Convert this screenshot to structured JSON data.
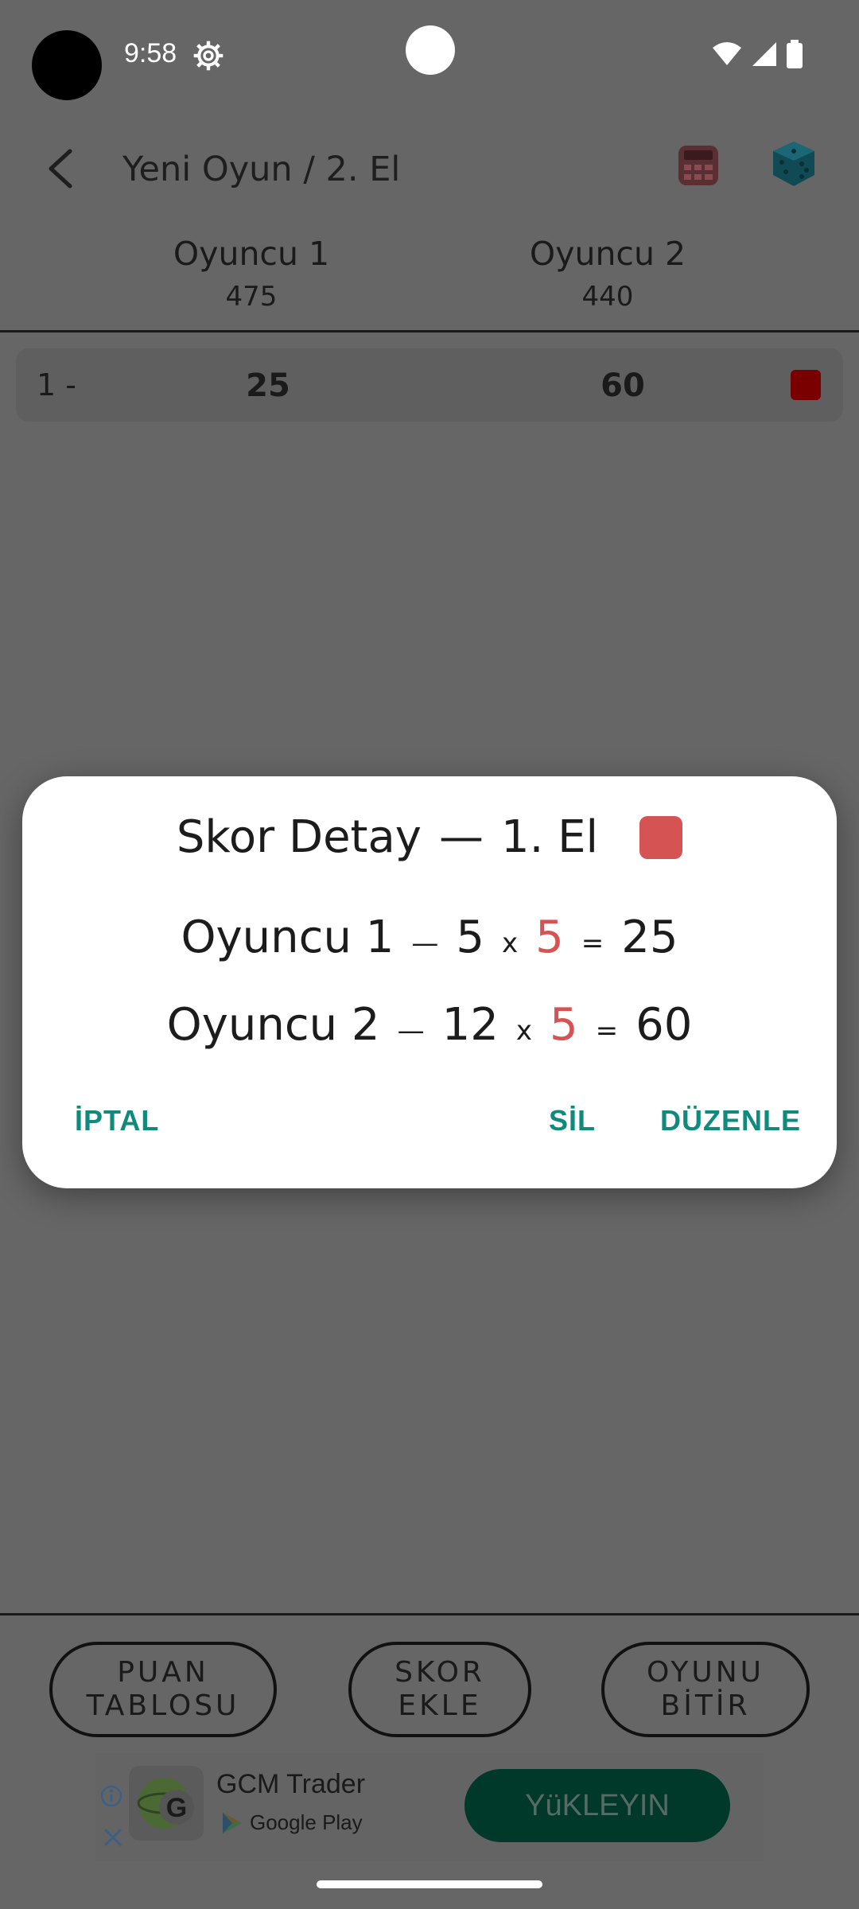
{
  "status_bar": {
    "time": "9:58"
  },
  "app_bar": {
    "title": "Yeni Oyun  /  2. El",
    "icons": [
      "back-arrow-icon",
      "calculator-icon",
      "dice-icon"
    ]
  },
  "players": [
    {
      "name": "Oyuncu 1",
      "score": "475"
    },
    {
      "name": "Oyuncu 2",
      "score": "440"
    }
  ],
  "rounds": [
    {
      "index": "1 -",
      "p1": "25",
      "p2": "60",
      "color": "#7a0000"
    }
  ],
  "dialog": {
    "title": "Skor Detay",
    "round": "1. El",
    "title_sep": "—",
    "color": "#d65353",
    "lines": [
      {
        "player": "Oyuncu 1",
        "dash": "—",
        "base": "5",
        "x": "x",
        "mult": "5",
        "eq": "=",
        "result": "25"
      },
      {
        "player": "Oyuncu 2",
        "dash": "—",
        "base": "12",
        "x": "x",
        "mult": "5",
        "eq": "=",
        "result": "60"
      }
    ],
    "buttons": {
      "cancel": "İPTAL",
      "delete": "SİL",
      "edit": "DÜZENLE"
    }
  },
  "bottom_buttons": {
    "score_table": "PUAN\nTABLOSU",
    "add_score": "SKOR\nEKLE",
    "finish_game": "OYUNU\nBİTİR"
  },
  "ad": {
    "app_name": "GCM Trader",
    "store": "Google Play",
    "install": "YüKLEYIN"
  }
}
